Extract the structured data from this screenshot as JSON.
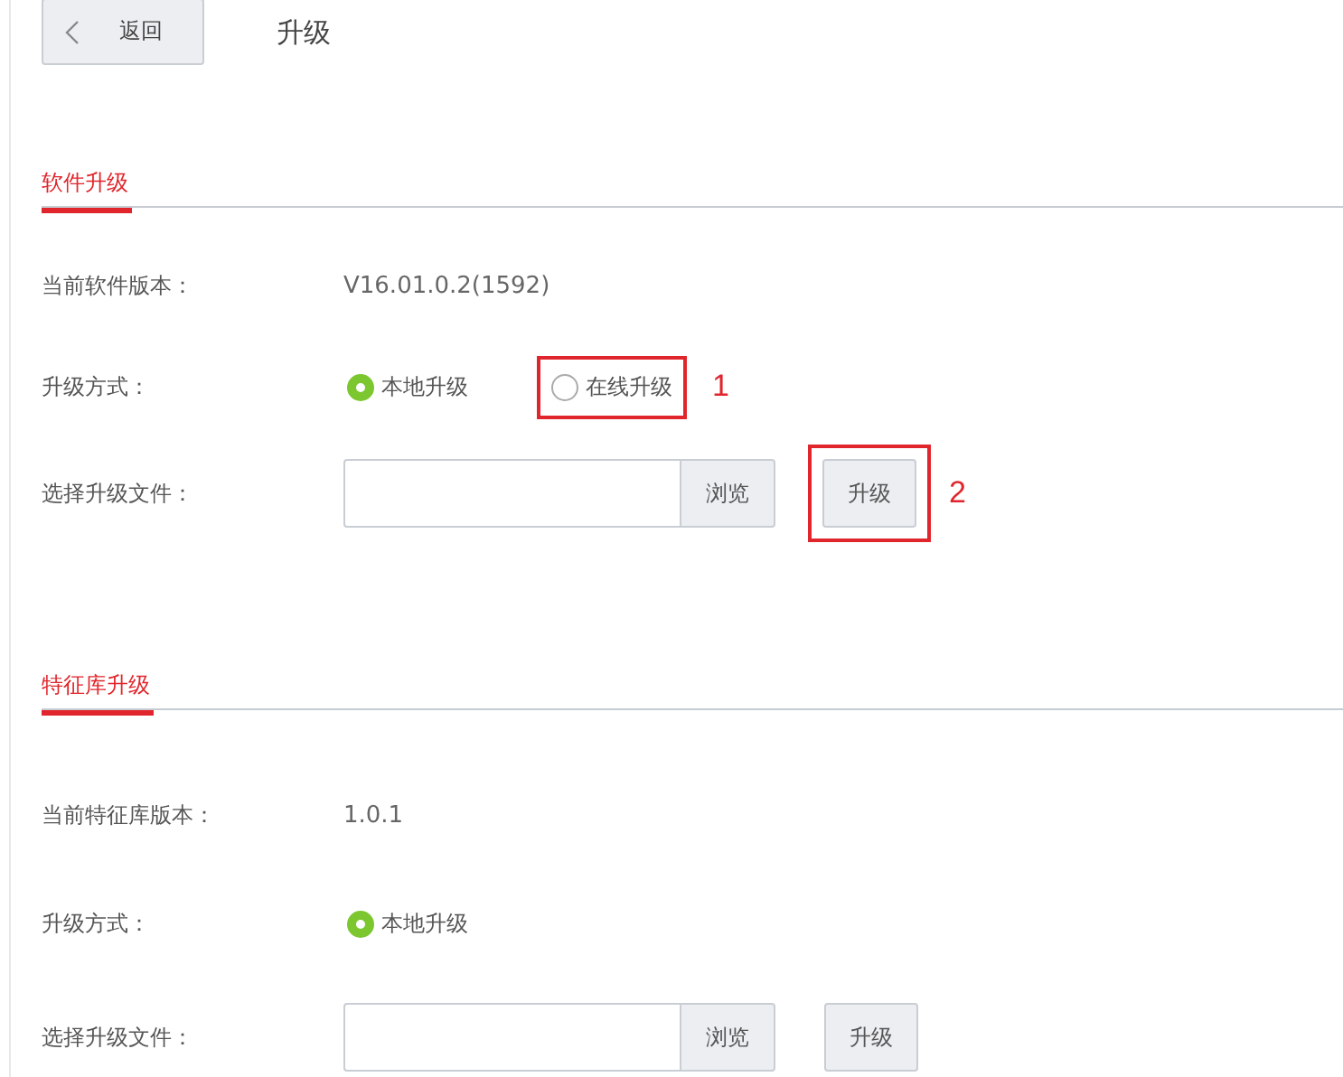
{
  "header": {
    "back_button": "返回",
    "title": "升级"
  },
  "sections": [
    {
      "title": "软件升级",
      "version_label": "当前软件版本：",
      "version": "V16.01.0.2(1592)",
      "method_label": "升级方式：",
      "methods": [
        {
          "label": "本地升级",
          "selected": true
        },
        {
          "label": "在线升级",
          "selected": false,
          "annotation": "1"
        }
      ],
      "file_label": "选择升级文件：",
      "browse_button": "浏览",
      "upgrade_button": "升级",
      "upgrade_annotation": "2"
    },
    {
      "title": "特征库升级",
      "version_label": "当前特征库版本：",
      "version": "1.0.1",
      "method_label": "升级方式：",
      "methods": [
        {
          "label": "本地升级",
          "selected": true
        }
      ],
      "file_label": "选择升级文件：",
      "browse_button": "浏览",
      "upgrade_button": "升级"
    }
  ]
}
